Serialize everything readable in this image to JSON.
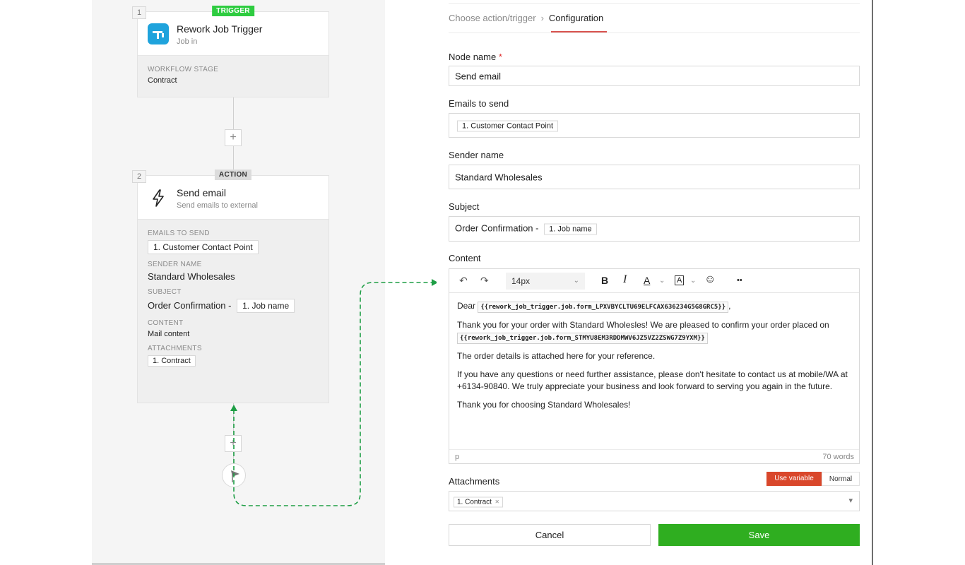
{
  "canvas": {
    "trigger_node": {
      "number": "1",
      "badge": "TRIGGER",
      "title": "Rework Job Trigger",
      "subtitle": "Job in",
      "field_label": "WORKFLOW STAGE",
      "field_value": "Contract"
    },
    "action_node": {
      "number": "2",
      "badge": "ACTION",
      "title": "Send email",
      "subtitle": "Send emails to external",
      "emails_label": "EMAILS TO SEND",
      "emails_value": "1. Customer Contact Point",
      "sender_label": "SENDER NAME",
      "sender_value": "Standard Wholesales",
      "subject_label": "SUBJECT",
      "subject_prefix": "Order Confirmation -",
      "subject_chip": "1. Job name",
      "content_label": "CONTENT",
      "content_value": "Mail content",
      "attachments_label": "ATTACHMENTS",
      "attachments_value": "1. Contract"
    },
    "plus_symbol": "+"
  },
  "panel": {
    "breadcrumb": {
      "step1": "Choose action/trigger",
      "separator": "›",
      "step2": "Configuration"
    },
    "node_name": {
      "label": "Node name",
      "required_mark": "*",
      "value": "Send email"
    },
    "emails_to_send": {
      "label": "Emails to send",
      "chip": "1. Customer Contact Point"
    },
    "sender_name": {
      "label": "Sender name",
      "value": "Standard Wholesales"
    },
    "subject": {
      "label": "Subject",
      "prefix": "Order Confirmation -",
      "chip": "1. Job name"
    },
    "content": {
      "label": "Content",
      "toolbar": {
        "undo": "↶",
        "redo": "↷",
        "font_size": "14px",
        "bold": "B",
        "italic": "I",
        "text_color": "A",
        "highlight": "A",
        "emoji": "☺",
        "more": "••",
        "caret": "⌄"
      },
      "body": {
        "greeting": "Dear",
        "var1": "{{rework_job_trigger.job.form_LPXVBYCLTU69ELFCAX636234G5G8GRC5}}",
        "greeting_end": ",",
        "p2_text": "Thank you for your order with Standard Wholesles! We are pleased to confirm your order placed on",
        "var2": "{{rework_job_trigger.job.form_STMYU8EM3RDDMWV6JZ5VZ2ZSWG7Z9YXM}}",
        "p3": "The order details is attached here for your reference.",
        "p4": "If you have any questions or need further assistance, please don't hesitate to contact us at mobile/WA at +6134-90840. We truly appreciate your business and look forward to serving you again in the future.",
        "p5": "Thank you for choosing Standard Wholesales!"
      },
      "footer_tag": "p",
      "word_count": "70 words"
    },
    "attachments": {
      "label": "Attachments",
      "mode_use_variable": "Use variable",
      "mode_normal": "Normal",
      "chip": "1. Contract",
      "chip_remove": "×",
      "dropdown_arrow": "▾"
    },
    "buttons": {
      "cancel": "Cancel",
      "save": "Save"
    }
  },
  "colors": {
    "trigger_badge": "#2ecc40",
    "save_button": "#2fae20",
    "use_variable": "#d9472b",
    "flow_arrow": "#1e9e45",
    "tab_underline": "#d9534f"
  }
}
